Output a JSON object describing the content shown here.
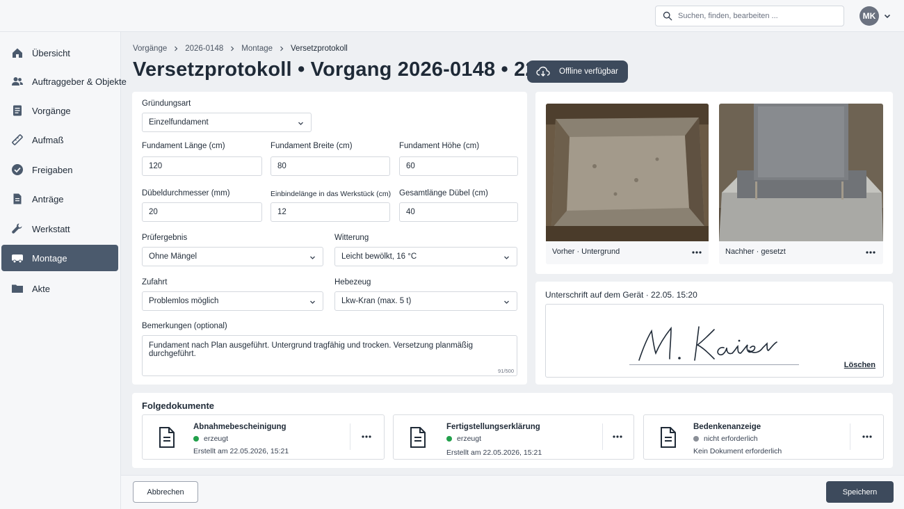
{
  "search": {
    "placeholder": "Suchen, finden, bearbeiten ..."
  },
  "user": {
    "initials": "MK"
  },
  "sidebar": {
    "items": [
      {
        "label": "Übersicht",
        "icon": "home-icon"
      },
      {
        "label": "Auftraggeber & Objekte",
        "icon": "people-icon"
      },
      {
        "label": "Vorgänge",
        "icon": "document-list-icon"
      },
      {
        "label": "Aufmaß",
        "icon": "ruler-icon"
      },
      {
        "label": "Freigaben",
        "icon": "check-circle-icon"
      },
      {
        "label": "Anträge",
        "icon": "document-icon"
      },
      {
        "label": "Werkstatt",
        "icon": "wrench-icon"
      },
      {
        "label": "Montage",
        "icon": "truck-icon",
        "active": true
      },
      {
        "label": "Akte",
        "icon": "folder-icon"
      }
    ]
  },
  "breadcrumb": [
    "Vorgänge",
    "2026-0148",
    "Montage",
    "Versetzprotokoll"
  ],
  "page": {
    "title": "Versetzprotokoll • Vorgang 2026-0148 • 22.05.",
    "offline_label": "Offline verfügbar"
  },
  "form": {
    "gruendungsart": {
      "label": "Gründungsart",
      "value": "Einzelfundament"
    },
    "fundament_laenge": {
      "label": "Fundament Länge (cm)",
      "value": "120"
    },
    "fundament_breite": {
      "label": "Fundament Breite (cm)",
      "value": "80"
    },
    "fundament_hoehe": {
      "label": "Fundament Höhe (cm)",
      "value": "60"
    },
    "duebeldurchmesser": {
      "label": "Dübeldurchmesser (mm)",
      "value": "20"
    },
    "einbindelaenge": {
      "label": "Einbindelänge in das Werkstück (cm)",
      "value": "12"
    },
    "gesamtlaenge": {
      "label": "Gesamtlänge Dübel (cm)",
      "value": "40"
    },
    "pruefergebnis": {
      "label": "Prüfergebnis",
      "value": "Ohne Mängel"
    },
    "witterung": {
      "label": "Witterung",
      "value": "Leicht bewölkt, 16 °C"
    },
    "zufahrt": {
      "label": "Zufahrt",
      "value": "Problemlos möglich"
    },
    "hebezeug": {
      "label": "Hebezeug",
      "value": "Lkw-Kran (max. 5 t)"
    },
    "bemerkungen": {
      "label": "Bemerkungen (optional)",
      "value": "Fundament nach Plan ausgeführt. Untergrund tragfähig und trocken. Versetzung planmäßig durchgeführt.",
      "counter": "91/500"
    }
  },
  "photos": [
    {
      "caption": "Vorher · Untergrund"
    },
    {
      "caption": "Nachher · gesetzt"
    }
  ],
  "signature": {
    "header": "Unterschrift auf dem Gerät · 22.05. 15:20",
    "name": "M. Kaiser",
    "delete_label": "Löschen"
  },
  "folgedokumente": {
    "title": "Folgedokumente",
    "items": [
      {
        "title": "Abnahmebescheinigung",
        "status": "erzeugt",
        "status_color": "#22a04b",
        "meta": "Erstellt am 22.05.2026, 15:21"
      },
      {
        "title": "Fertigstellungserklärung",
        "status": "erzeugt",
        "status_color": "#22a04b",
        "meta": "Erstellt am 22.05.2026, 15:21"
      },
      {
        "title": "Bedenkenanzeige",
        "status": "nicht erforderlich",
        "status_color": "#8a8f97",
        "meta": "Kein Dokument erforderlich"
      }
    ]
  },
  "footer": {
    "cancel_label": "Abbrechen",
    "save_label": "Speichern"
  },
  "colors": {
    "primary": "#3d4a5c",
    "active_nav": "#4b5a6d",
    "success": "#22a04b"
  }
}
